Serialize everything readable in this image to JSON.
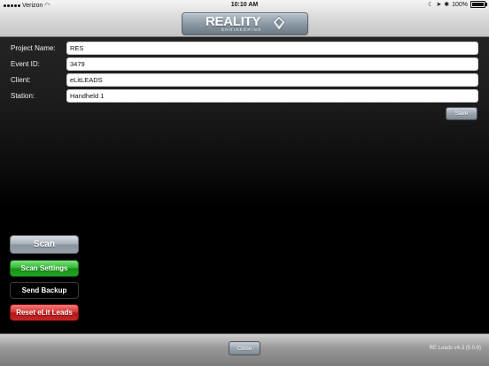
{
  "status_bar": {
    "carrier": "Verizon",
    "time": "10:10 AM",
    "battery": "100%"
  },
  "header": {
    "logo_word": "REALITY",
    "logo_sub": "ENGINEERING"
  },
  "form": {
    "fields": [
      {
        "label": "Project Name:",
        "value": "RES"
      },
      {
        "label": "Event ID:",
        "value": "3479"
      },
      {
        "label": "Client:",
        "value": "eLitLEADS"
      },
      {
        "label": "Station:",
        "value": "Handheld 1"
      }
    ],
    "save_label": "Save"
  },
  "actions": {
    "scan": "Scan",
    "scan_settings": "Scan Settings",
    "send_backup": "Send Backup",
    "reset": "Reset eLit Leads"
  },
  "footer": {
    "close_label": "Close",
    "version": "RE Leads v4.3 (5.0.6)"
  },
  "colors": {
    "settings_green": "#2fb82f",
    "reset_red": "#d43434",
    "header_steel": "#8c9aa5"
  }
}
